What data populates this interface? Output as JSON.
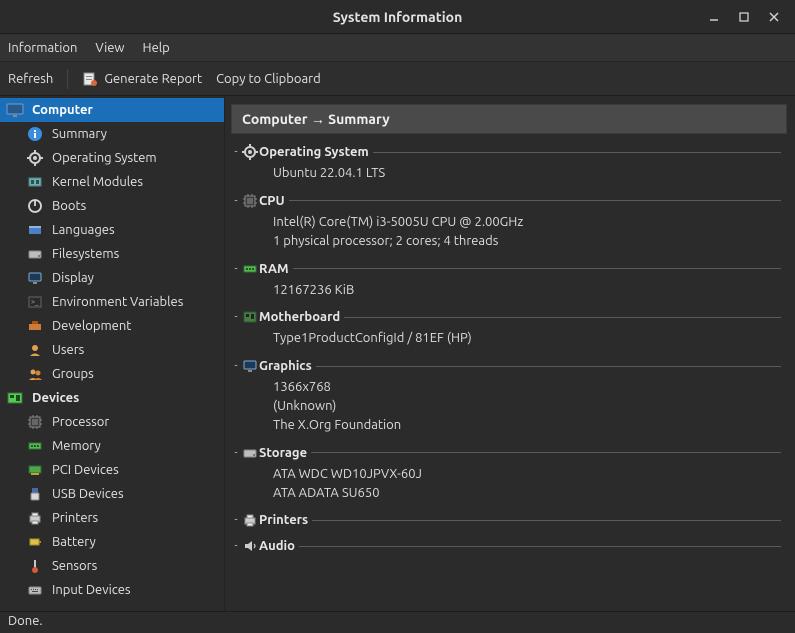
{
  "window": {
    "title": "System Information"
  },
  "menubar": {
    "items": [
      "Information",
      "View",
      "Help"
    ]
  },
  "toolbar": {
    "refresh": "Refresh",
    "generate_report": "Generate Report",
    "copy_clipboard": "Copy to Clipboard"
  },
  "sidebar": {
    "categories": [
      {
        "label": "Computer",
        "selected": true,
        "items": [
          {
            "label": "Summary",
            "icon": "info-icon"
          },
          {
            "label": "Operating System",
            "icon": "gear-icon"
          },
          {
            "label": "Kernel Modules",
            "icon": "modules-icon"
          },
          {
            "label": "Boots",
            "icon": "power-icon"
          },
          {
            "label": "Languages",
            "icon": "flag-icon"
          },
          {
            "label": "Filesystems",
            "icon": "disk-icon"
          },
          {
            "label": "Display",
            "icon": "display-icon"
          },
          {
            "label": "Environment Variables",
            "icon": "terminal-icon"
          },
          {
            "label": "Development",
            "icon": "dev-icon"
          },
          {
            "label": "Users",
            "icon": "user-icon"
          },
          {
            "label": "Groups",
            "icon": "groups-icon"
          }
        ]
      },
      {
        "label": "Devices",
        "items": [
          {
            "label": "Processor",
            "icon": "cpu-icon"
          },
          {
            "label": "Memory",
            "icon": "ram-icon"
          },
          {
            "label": "PCI Devices",
            "icon": "pci-icon"
          },
          {
            "label": "USB Devices",
            "icon": "usb-icon"
          },
          {
            "label": "Printers",
            "icon": "printer-icon"
          },
          {
            "label": "Battery",
            "icon": "battery-icon"
          },
          {
            "label": "Sensors",
            "icon": "sensor-icon"
          },
          {
            "label": "Input Devices",
            "icon": "input-icon"
          }
        ]
      }
    ]
  },
  "main": {
    "breadcrumb": "Computer → Summary",
    "sections": [
      {
        "title": "Operating System",
        "icon": "gear-icon",
        "lines": [
          "Ubuntu 22.04.1 LTS"
        ]
      },
      {
        "title": "CPU",
        "icon": "cpu-icon",
        "lines": [
          "Intel(R) Core(TM) i3-5005U CPU @ 2.00GHz",
          "1 physical processor; 2 cores; 4 threads"
        ]
      },
      {
        "title": "RAM",
        "icon": "ram-icon",
        "lines": [
          "12167236 KiB"
        ]
      },
      {
        "title": "Motherboard",
        "icon": "board-icon",
        "lines": [
          "Type1ProductConfigId / 81EF (HP)"
        ]
      },
      {
        "title": "Graphics",
        "icon": "display-icon",
        "lines": [
          "1366x768",
          "(Unknown)",
          "The X.Org Foundation"
        ]
      },
      {
        "title": "Storage",
        "icon": "disk-icon",
        "lines": [
          "ATA WDC WD10JPVX-60J",
          "ATA ADATA SU650"
        ]
      },
      {
        "title": "Printers",
        "icon": "printer-icon",
        "lines": []
      },
      {
        "title": "Audio",
        "icon": "audio-icon",
        "lines": []
      }
    ]
  },
  "status": {
    "text": "Done."
  },
  "icon_colors": {
    "info": "#3a8de0",
    "gear": "#cfcfcf",
    "cpu": "#5a5a5a",
    "ram": "#5ab85a",
    "flag": "#4a80c8",
    "disk": "#bdbdbd",
    "display": "#6aa0d8",
    "terminal": "#2a2a2a",
    "dev": "#d07a3a",
    "user": "#e0a050",
    "power": "#d8d8d8",
    "usb": "#d8d8d8",
    "printer": "#cccccc",
    "battery": "#e0c050",
    "sensor": "#c8c8c8",
    "pci": "#4aa84a",
    "board": "#aaaaaa",
    "audio": "#cccccc",
    "input": "#bbbbbb",
    "monitor_cat": "#6aa0d8",
    "devices_cat": "#5cc85c"
  }
}
